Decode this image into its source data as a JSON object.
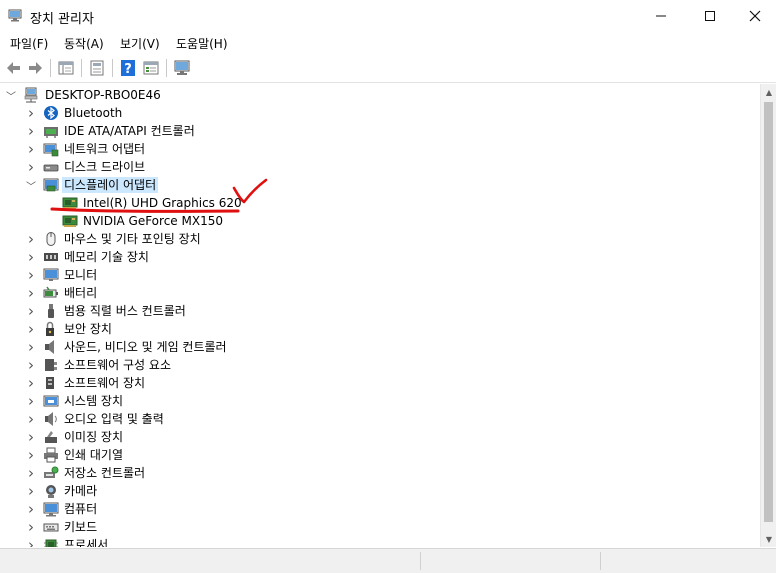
{
  "window": {
    "title": "장치 관리자"
  },
  "menu": [
    "파일(F)",
    "동작(A)",
    "보기(V)",
    "도움말(H)"
  ],
  "tree": {
    "root": "DESKTOP-RBO0E46",
    "categories": [
      {
        "label": "Bluetooth",
        "icon": "bluetooth-icon",
        "expanded": false
      },
      {
        "label": "IDE ATA/ATAPI 컨트롤러",
        "icon": "ide-controller-icon",
        "expanded": false
      },
      {
        "label": "네트워크 어댑터",
        "icon": "network-adapter-icon",
        "expanded": false
      },
      {
        "label": "디스크 드라이브",
        "icon": "disk-drive-icon",
        "expanded": false
      },
      {
        "label": "디스플레이 어댑터",
        "icon": "display-adapter-icon",
        "expanded": true,
        "children": [
          "Intel(R) UHD Graphics 620",
          "NVIDIA GeForce MX150"
        ]
      },
      {
        "label": "마우스 및 기타 포인팅 장치",
        "icon": "mouse-icon",
        "expanded": false
      },
      {
        "label": "메모리 기술 장치",
        "icon": "memory-icon",
        "expanded": false
      },
      {
        "label": "모니터",
        "icon": "monitor-icon",
        "expanded": false
      },
      {
        "label": "배터리",
        "icon": "battery-icon",
        "expanded": false
      },
      {
        "label": "범용 직렬 버스 컨트롤러",
        "icon": "usb-icon",
        "expanded": false
      },
      {
        "label": "보안 장치",
        "icon": "security-device-icon",
        "expanded": false
      },
      {
        "label": "사운드, 비디오 및 게임 컨트롤러",
        "icon": "sound-icon",
        "expanded": false
      },
      {
        "label": "소프트웨어 구성 요소",
        "icon": "software-component-icon",
        "expanded": false
      },
      {
        "label": "소프트웨어 장치",
        "icon": "software-device-icon",
        "expanded": false
      },
      {
        "label": "시스템 장치",
        "icon": "system-device-icon",
        "expanded": false
      },
      {
        "label": "오디오 입력 및 출력",
        "icon": "audio-io-icon",
        "expanded": false
      },
      {
        "label": "이미징 장치",
        "icon": "imaging-icon",
        "expanded": false
      },
      {
        "label": "인쇄 대기열",
        "icon": "print-queue-icon",
        "expanded": false
      },
      {
        "label": "저장소 컨트롤러",
        "icon": "storage-controller-icon",
        "expanded": false
      },
      {
        "label": "카메라",
        "icon": "camera-icon",
        "expanded": false
      },
      {
        "label": "컴퓨터",
        "icon": "computer-icon",
        "expanded": false
      },
      {
        "label": "키보드",
        "icon": "keyboard-icon",
        "expanded": false
      },
      {
        "label": "프로세서",
        "icon": "processor-icon",
        "expanded": false
      }
    ]
  },
  "colors": {
    "selection": "#cce8ff",
    "annotation": "#e01010"
  }
}
